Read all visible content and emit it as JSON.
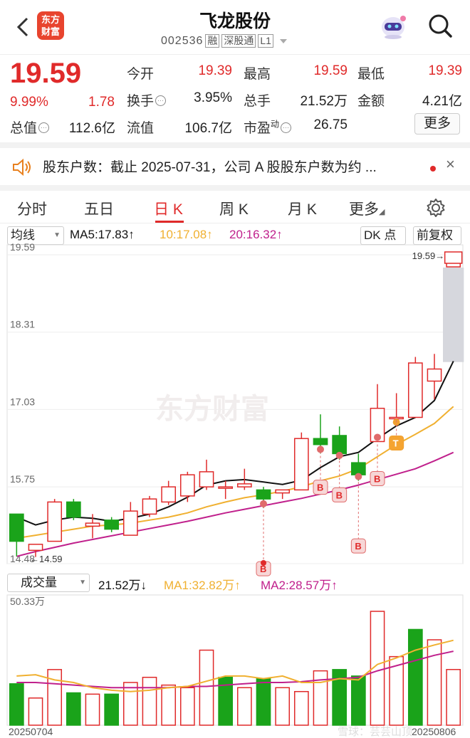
{
  "header": {
    "title": "飞龙股份",
    "code": "002536",
    "tags": [
      "融",
      "深股通",
      "L1"
    ],
    "logo_text": "东方财富",
    "icons": [
      "back-icon",
      "robot-avatar-icon",
      "search-icon"
    ]
  },
  "quote": {
    "price": "19.59",
    "pct": "9.99%",
    "change": "1.78",
    "rows": [
      [
        {
          "label": "今开",
          "value": "19.39"
        },
        {
          "label": "最高",
          "value": "19.59"
        },
        {
          "label": "最低",
          "value": "19.39"
        }
      ],
      [
        {
          "label": "换手",
          "value": "3.95%"
        },
        {
          "label": "总手",
          "value": "21.52万"
        },
        {
          "label": "金额",
          "value": "4.21亿"
        }
      ],
      [
        {
          "label": "流值",
          "value": "106.7亿"
        },
        {
          "label": "市盈",
          "sup": "动",
          "value": "26.75"
        }
      ]
    ],
    "total_label": "总值",
    "total_value": "112.6亿",
    "more_label": "更多",
    "colors": {
      "up": "#e02a2a",
      "down": "#1aa31a"
    }
  },
  "notice": {
    "text": "股东户数：截止 2025-07-31，公司 A 股股东户数为约 ...",
    "icon": "speaker-icon",
    "close": "×"
  },
  "tabs": [
    "分时",
    "五日",
    "日 K",
    "周 K",
    "月 K",
    "更多"
  ],
  "active_tab": "日 K",
  "settings_icon": "gear-icon",
  "chart_controls": {
    "ma_select": "均线",
    "ma5": "MA5:17.83↑",
    "ma10": "10:17.08↑",
    "ma20": "20:16.32↑",
    "dk": "DK 点",
    "adjust": "前复权",
    "vol_select": "成交量",
    "vol_value": "21.52万↓",
    "vol_ma1": "MA1:32.82万↑",
    "vol_ma2": "MA2:28.57万↑",
    "watermark": "东方财富",
    "footer_watermark": "雪球：芸芸山顶",
    "colors": {
      "ma5": "#111111",
      "ma10": "#f0b030",
      "ma20": "#c0208c",
      "up": "#e02a2a",
      "down": "#1aa31a"
    }
  },
  "chart_data": [
    {
      "type": "candlestick",
      "y_ticks": [
        "19.59",
        "18.31",
        "17.03",
        "15.75",
        "14.48"
      ],
      "ylim": [
        14.48,
        19.59
      ],
      "max_label": "19.59→",
      "min_label": "←14.59",
      "candles": [
        {
          "o": 15.3,
          "h": 15.3,
          "c": 14.85,
          "l": 14.6
        },
        {
          "o": 14.7,
          "h": 14.8,
          "c": 14.8,
          "l": 14.59
        },
        {
          "o": 14.85,
          "h": 15.55,
          "c": 15.5,
          "l": 14.85
        },
        {
          "o": 15.5,
          "h": 15.55,
          "c": 15.25,
          "l": 15.2
        },
        {
          "o": 15.1,
          "h": 15.3,
          "c": 15.15,
          "l": 14.9
        },
        {
          "o": 15.2,
          "h": 15.25,
          "c": 15.05,
          "l": 15.0
        },
        {
          "o": 14.95,
          "h": 15.5,
          "c": 15.35,
          "l": 14.95
        },
        {
          "o": 15.3,
          "h": 15.6,
          "c": 15.55,
          "l": 15.25
        },
        {
          "o": 15.5,
          "h": 15.85,
          "c": 15.75,
          "l": 15.45
        },
        {
          "o": 15.6,
          "h": 16.0,
          "c": 15.95,
          "l": 15.5
        },
        {
          "o": 15.75,
          "h": 16.2,
          "c": 16.0,
          "l": 15.7
        },
        {
          "o": 15.75,
          "h": 15.85,
          "c": 15.75,
          "l": 15.55
        },
        {
          "o": 15.75,
          "h": 16.05,
          "c": 15.8,
          "l": 15.7
        },
        {
          "o": 15.7,
          "h": 15.75,
          "c": 15.55,
          "l": 15.4
        },
        {
          "o": 15.65,
          "h": 15.7,
          "c": 15.7,
          "l": 15.55
        },
        {
          "o": 15.7,
          "h": 16.65,
          "c": 16.55,
          "l": 15.7
        },
        {
          "o": 16.55,
          "h": 16.95,
          "c": 16.45,
          "l": 16.3
        },
        {
          "o": 16.6,
          "h": 16.75,
          "c": 16.3,
          "l": 16.2
        },
        {
          "o": 16.15,
          "h": 16.3,
          "c": 15.95,
          "l": 15.85
        },
        {
          "o": 16.5,
          "h": 17.45,
          "c": 17.05,
          "l": 16.5
        },
        {
          "o": 16.9,
          "h": 17.3,
          "c": 16.9,
          "l": 16.75
        },
        {
          "o": 16.9,
          "h": 17.9,
          "c": 17.8,
          "l": 16.9
        },
        {
          "o": 17.5,
          "h": 17.95,
          "c": 17.7,
          "l": 17.2
        },
        {
          "o": 19.39,
          "h": 19.59,
          "c": 19.59,
          "l": 19.39
        }
      ],
      "ma5": [
        15.25,
        15.12,
        15.2,
        15.25,
        15.23,
        15.18,
        15.23,
        15.3,
        15.42,
        15.58,
        15.78,
        15.85,
        15.87,
        15.83,
        15.79,
        15.86,
        16.07,
        16.25,
        16.32,
        16.55,
        16.76,
        16.9,
        17.18,
        17.83
      ],
      "ma10": [
        14.9,
        14.95,
        15.0,
        15.05,
        15.1,
        15.12,
        15.15,
        15.2,
        15.25,
        15.32,
        15.42,
        15.5,
        15.57,
        15.62,
        15.68,
        15.75,
        15.85,
        15.93,
        16.05,
        16.25,
        16.45,
        16.62,
        16.8,
        17.08
      ],
      "ma20": [
        14.6,
        14.68,
        14.75,
        14.82,
        14.88,
        14.94,
        15.0,
        15.06,
        15.12,
        15.18,
        15.25,
        15.32,
        15.38,
        15.44,
        15.5,
        15.56,
        15.63,
        15.7,
        15.78,
        15.87,
        15.96,
        16.05,
        16.18,
        16.32
      ],
      "signals": [
        {
          "index": 13,
          "label": "B",
          "kind": "buy"
        },
        {
          "index": 16,
          "label": "B",
          "kind": "buy"
        },
        {
          "index": 17,
          "label": "B",
          "kind": "buy"
        },
        {
          "index": 18,
          "label": "B",
          "kind": "buy"
        },
        {
          "index": 19,
          "label": "B",
          "kind": "buy"
        },
        {
          "index": 20,
          "label": "T",
          "kind": "t"
        }
      ]
    },
    {
      "type": "bar",
      "title": "成交量",
      "y_top_label": "50.33万",
      "ylim": [
        0,
        50.33
      ],
      "x_start_label": "20250704",
      "x_end_label": "20250806",
      "values": [
        16.0,
        10.5,
        21.5,
        12.5,
        12.0,
        12.0,
        16.5,
        18.5,
        15.5,
        14.5,
        29.0,
        18.5,
        14.5,
        18.0,
        14.5,
        13.0,
        21.0,
        21.5,
        19.0,
        44.0,
        26.5,
        37.0,
        33.0,
        21.52
      ],
      "up": [
        false,
        true,
        true,
        false,
        true,
        false,
        true,
        true,
        true,
        true,
        true,
        false,
        true,
        false,
        true,
        true,
        true,
        false,
        false,
        true,
        true,
        false,
        true,
        true
      ],
      "ma1": [
        19.0,
        19.5,
        17.5,
        16.5,
        14.5,
        13.5,
        13.0,
        13.5,
        14.5,
        15.0,
        17.0,
        19.0,
        19.0,
        18.0,
        19.0,
        16.5,
        16.5,
        18.0,
        17.5,
        23.5,
        26.0,
        29.0,
        31.0,
        32.82
      ],
      "ma2": [
        16.5,
        16.5,
        16.0,
        15.5,
        15.0,
        14.5,
        14.5,
        14.5,
        14.5,
        15.0,
        15.0,
        15.5,
        16.0,
        16.5,
        16.5,
        16.8,
        17.5,
        18.0,
        18.5,
        21.0,
        23.0,
        25.0,
        27.0,
        28.57
      ]
    }
  ]
}
